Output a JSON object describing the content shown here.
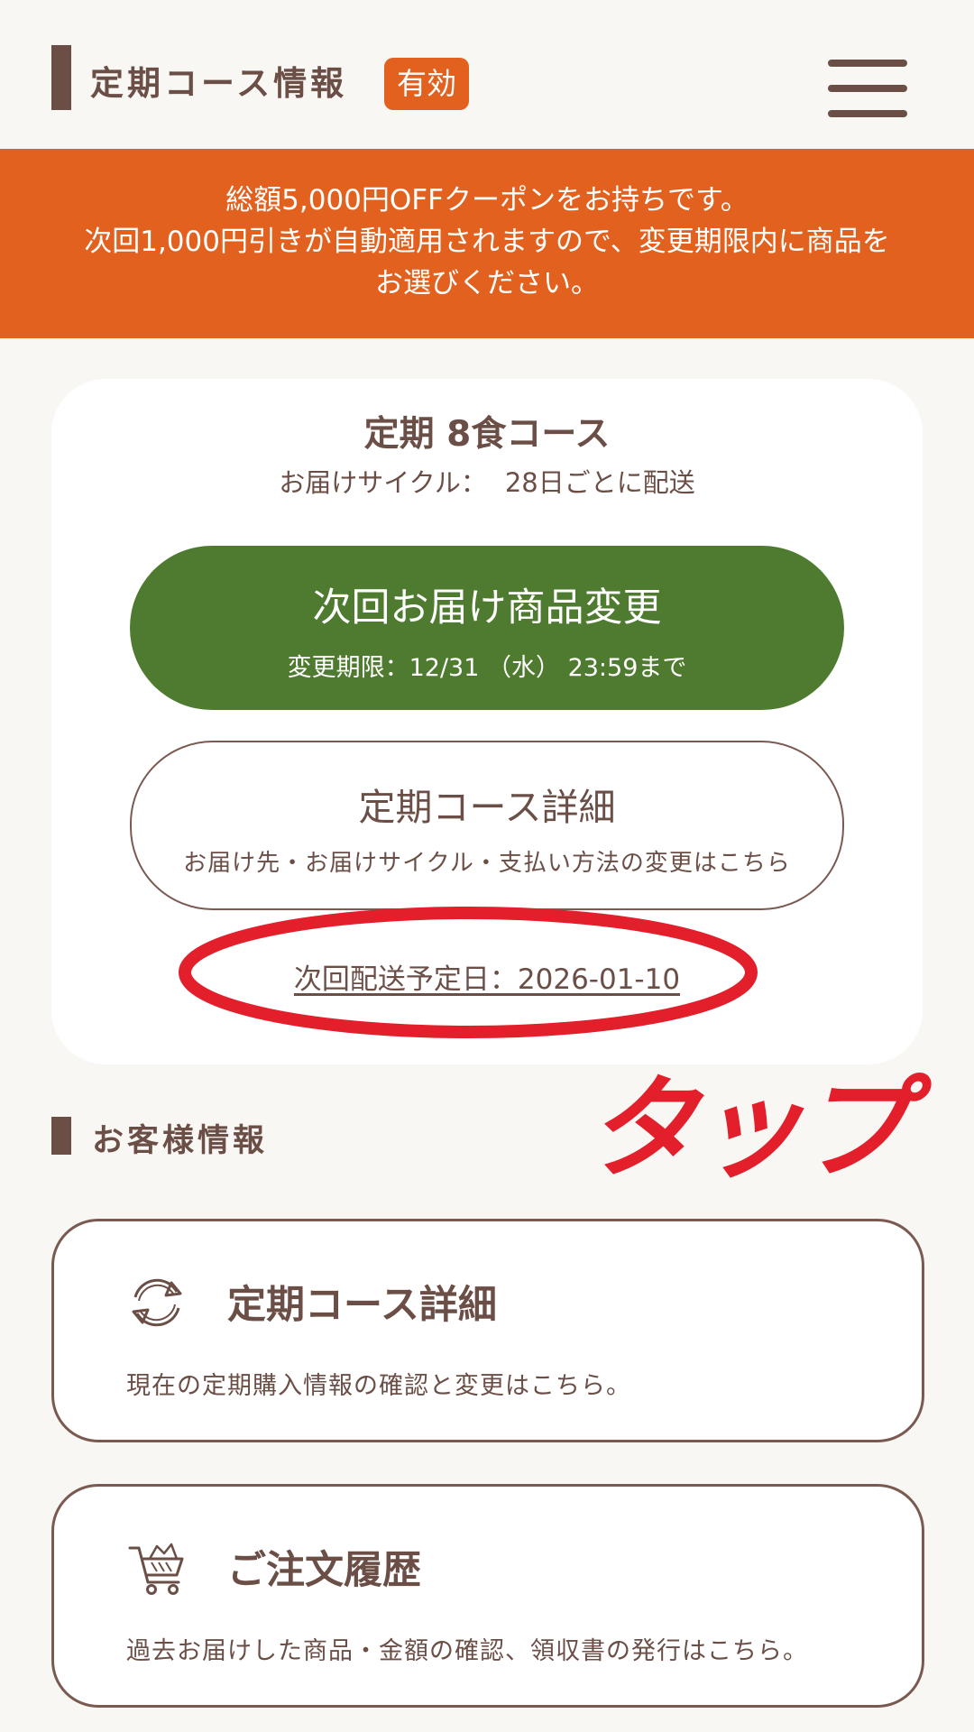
{
  "header": {
    "title": "定期コース情報",
    "badge": "有効",
    "menu_icon": "hamburger-menu-icon"
  },
  "banner": {
    "line1": "総額5,000円OFFクーポンをお持ちです。",
    "line2": "次回1,000円引きが自動適用されますので、変更期限内に商品を",
    "line3": "お選びください。"
  },
  "course": {
    "title": "定期 8食コース",
    "cycle_label": "お届けサイクル：",
    "cycle_value": "28日ごとに配送",
    "change_button": {
      "label": "次回お届け商品変更",
      "deadline": "変更期限：12/31 （水） 23:59まで"
    },
    "detail_button": {
      "label": "定期コース詳細",
      "sub": "お届け先・お届けサイクル・支払い方法の変更はこちら"
    },
    "next_delivery": "次回配送予定日：2026-01-10"
  },
  "annotation": {
    "text": "タップ",
    "color": "#e21f2a"
  },
  "customer_section": {
    "title": "お客様情報",
    "cards": [
      {
        "icon": "refresh-cycle-icon",
        "title": "定期コース詳細",
        "desc": "現在の定期購入情報の確認と変更はこちら。"
      },
      {
        "icon": "shopping-cart-icon",
        "title": "ご注文履歴",
        "desc": "過去お届けした商品・金額の確認、領収書の発行はこちら。"
      }
    ]
  },
  "colors": {
    "accent": "#e2611f",
    "green": "#4e7b2f",
    "text": "#6b4f47",
    "background": "#f9f7f4"
  }
}
